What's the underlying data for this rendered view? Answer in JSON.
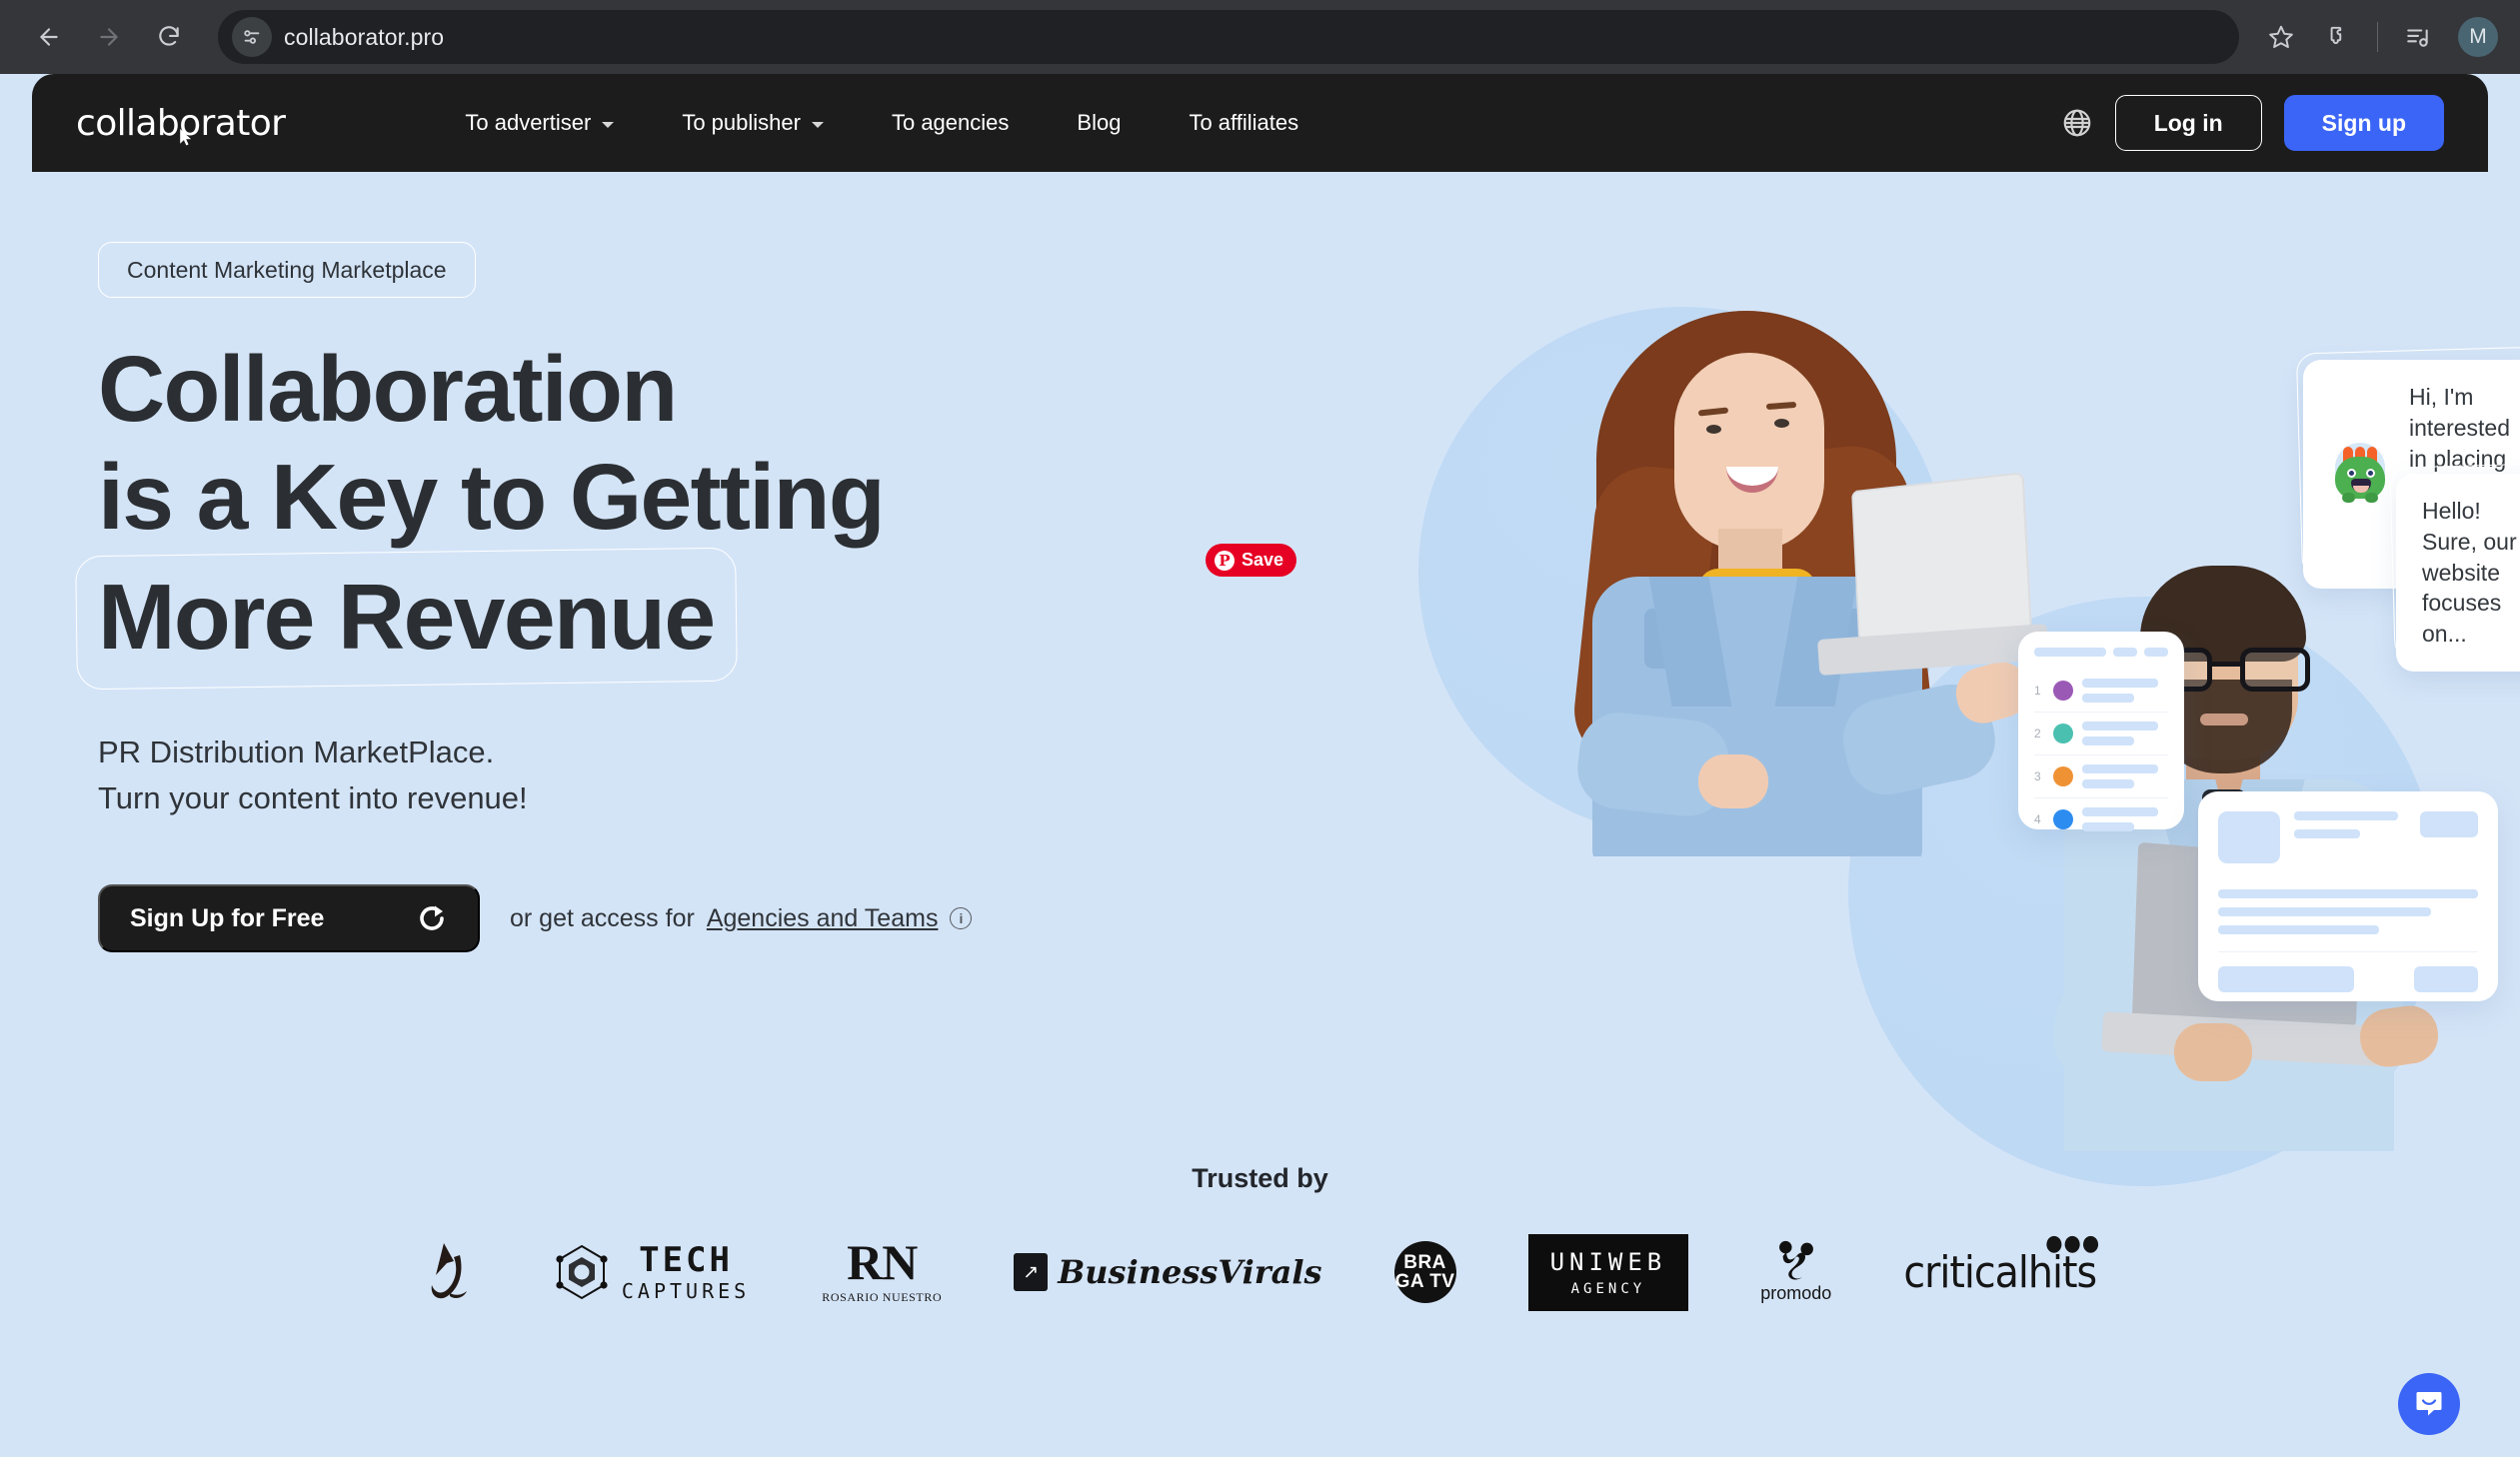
{
  "browser": {
    "url": "collaborator.pro",
    "back_label": "Back",
    "forward_label": "Forward",
    "reload_label": "Reload",
    "site_info_label": "View site information",
    "bookmark_label": "Bookmark this tab",
    "extensions_label": "Extensions",
    "media_label": "Media controls",
    "profile_initial": "M"
  },
  "header": {
    "logo_text": "collaborator",
    "nav": [
      {
        "label": "To advertiser",
        "has_caret": true
      },
      {
        "label": "To publisher",
        "has_caret": true
      },
      {
        "label": "To agencies",
        "has_caret": false
      },
      {
        "label": "Blog",
        "has_caret": false
      },
      {
        "label": "To affiliates",
        "has_caret": false
      }
    ],
    "language_icon": "globe-icon",
    "login_label": "Log in",
    "signup_label": "Sign up",
    "accent_color": "#3b65f6",
    "bar_color": "#1c1c1c"
  },
  "hero": {
    "badge": "Content Marketing Marketplace",
    "headline_line1": "Collaboration",
    "headline_line2": "is a Key to Getting",
    "headline_line3": "More Revenue",
    "subhead_line1": "PR Distribution MarketPlace.",
    "subhead_line2": "Turn your content into revenue!",
    "cta_label": "Sign Up for Free",
    "cta_note_prefix": "or get access for",
    "cta_note_link": "Agencies and Teams",
    "info_glyph": "i",
    "background_color": "#d4e4f7"
  },
  "pinterest": {
    "label": "Save",
    "glyph": "P",
    "color": "#e60023"
  },
  "illustration": {
    "bubbles": [
      {
        "text": "Hi, I'm interested in placing ads on your website",
        "avatar": "green-monster",
        "side": "left"
      },
      {
        "text": "Hello! Sure, our website focuses on...",
        "avatar": "lime-monster",
        "side": "right"
      }
    ],
    "list_card": {
      "rows": [
        {
          "num": "1",
          "color": "#9b59b6"
        },
        {
          "num": "2",
          "color": "#4ac0b0"
        },
        {
          "num": "3",
          "color": "#ef9234"
        },
        {
          "num": "4",
          "color": "#2d8cf0"
        }
      ]
    }
  },
  "trusted": {
    "title": "Trusted by",
    "brands": [
      {
        "name": "mark-logo",
        "text": ""
      },
      {
        "name": "tech-captures",
        "line1": "TECH",
        "line2": "CAPTURES"
      },
      {
        "name": "rosario-nuestro",
        "abbr": "RN",
        "sub": "ROSARIO NUESTRO"
      },
      {
        "name": "business-virals",
        "text": "BusinessVirals"
      },
      {
        "name": "braga-tv",
        "line1": "BRA",
        "line2": "GA TV"
      },
      {
        "name": "uniweb-agency",
        "line1": "UNIWEB",
        "line2": "AGENCY"
      },
      {
        "name": "promodo",
        "text": "promodo"
      },
      {
        "name": "criticalhits",
        "text": "criticalhits"
      }
    ]
  },
  "intercom": {
    "label": "Open chat",
    "color": "#3b65f6"
  }
}
